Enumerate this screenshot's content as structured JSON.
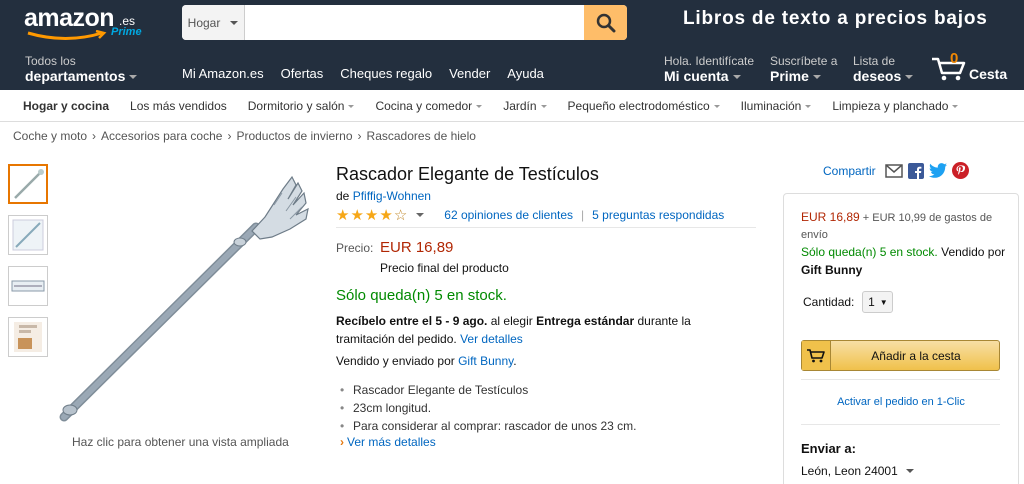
{
  "header": {
    "logo_text": "amazon",
    "logo_tld": ".es",
    "logo_prime": "Prime",
    "search_category": "Hogar",
    "search_value": "",
    "promo": "Libros de texto a precios bajos",
    "departments_line1": "Todos los",
    "departments_line2": "departamentos",
    "links": [
      "Mi Amazon.es",
      "Ofertas",
      "Cheques regalo",
      "Vender",
      "Ayuda"
    ],
    "account_line1": "Hola. Identifícate",
    "account_line2": "Mi cuenta",
    "prime_line1": "Suscríbete a",
    "prime_line2": "Prime",
    "wishlist_line1": "Lista de",
    "wishlist_line2": "deseos",
    "cart_count": "0",
    "cart_label": "Cesta"
  },
  "subnav": [
    {
      "label": "Hogar y cocina",
      "caret": false
    },
    {
      "label": "Los más vendidos",
      "caret": false
    },
    {
      "label": "Dormitorio y salón",
      "caret": true
    },
    {
      "label": "Cocina y comedor",
      "caret": true
    },
    {
      "label": "Jardín",
      "caret": true
    },
    {
      "label": "Pequeño electrodoméstico",
      "caret": true
    },
    {
      "label": "Iluminación",
      "caret": true
    },
    {
      "label": "Limpieza y planchado",
      "caret": true
    }
  ],
  "breadcrumb": [
    "Coche y moto",
    "Accesorios para coche",
    "Productos de invierno",
    "Rascadores de hielo"
  ],
  "image_caption": "Haz clic para obtener una vista ampliada",
  "product": {
    "title": "Rascador Elegante de Testículos",
    "by_prefix": "de",
    "brand": "Pfiffig-Wohnen",
    "rating": 4,
    "rating_max": 5,
    "reviews": "62 opiniones de clientes",
    "separator": "|",
    "questions": "5 preguntas respondidas",
    "price_label": "Precio:",
    "price": "EUR 16,89",
    "price_note": "Precio final del producto",
    "stock": "Sólo queda(n) 5 en stock.",
    "delivery_bold1": "Recíbelo entre el 5 - 9 ago.",
    "delivery_text1": " al elegir ",
    "delivery_bold2": "Entrega estándar",
    "delivery_text2": " durante la tramitación del pedido. ",
    "delivery_link": "Ver detalles",
    "sold_prefix": "Vendido y enviado por ",
    "seller": "Gift Bunny",
    "sold_suffix": ".",
    "bullets": [
      "Rascador Elegante de Testículos",
      "23cm longitud.",
      "Para considerar al comprar: rascador de unos 23 cm."
    ],
    "more_chevron": "›",
    "more_details": "Ver más detalles"
  },
  "share": {
    "label": "Compartir"
  },
  "buybox": {
    "price": "EUR 16,89",
    "shipping": " + EUR 10,99 de gastos de envío",
    "stock": "Sólo queda(n) 5 en stock.",
    "sold_prefix": " Vendido por ",
    "seller": "Gift Bunny",
    "qty_label": "Cantidad:",
    "qty_value": "1",
    "add_to_cart": "Añadir a la cesta",
    "one_click": "Activar el pedido en 1-Clic",
    "ship_to_label": "Enviar a:",
    "ship_to_value": "León, Leon 24001"
  },
  "colors": {
    "nav": "#232f3e",
    "accent": "#febd69",
    "price": "#b12704",
    "stock": "#008a00",
    "link": "#0066c0"
  }
}
